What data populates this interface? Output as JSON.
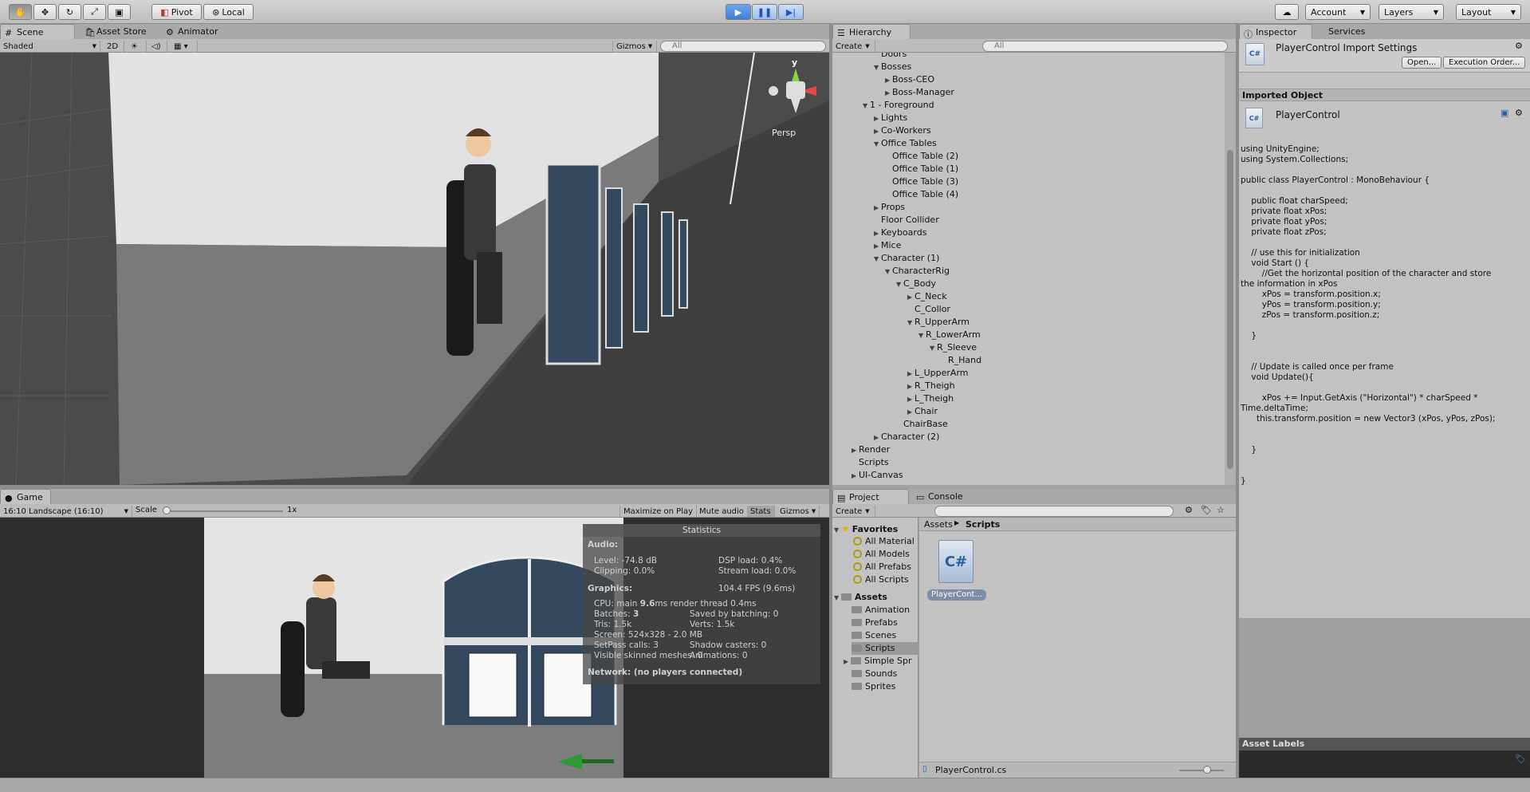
{
  "toolbar": {
    "pivot": "Pivot",
    "local": "Local",
    "account": "Account",
    "layers": "Layers",
    "layout": "Layout"
  },
  "scene": {
    "tab": "Scene",
    "tab2": "Asset Store",
    "tab3": "Animator",
    "shaded": "Shaded",
    "two_d": "2D",
    "gizmos": "Gizmos",
    "search": "All",
    "persp": "Persp",
    "axis_y": "y"
  },
  "game": {
    "tab": "Game",
    "aspect": "16:10 Landscape (16:10)",
    "scale_label": "Scale",
    "scale_val": "1x",
    "maximize": "Maximize on Play",
    "mute": "Mute audio",
    "stats": "Stats",
    "gizmos": "Gizmos"
  },
  "stats": {
    "title": "Statistics",
    "audio_h": "Audio:",
    "level": "Level: -74.8 dB",
    "clipping": "Clipping: 0.0%",
    "dsp": "DSP load: 0.4%",
    "stream": "Stream load: 0.0%",
    "graphics_h": "Graphics:",
    "fps": "104.4 FPS (9.6ms)",
    "cpu_pre": "CPU: main ",
    "cpu_main": "9.6",
    "cpu_post": "ms  render thread 0.4ms",
    "batches_pre": "Batches: ",
    "batches": "3",
    "saved": "Saved by batching: 0",
    "tris": "Tris: 1.5k",
    "verts": "Verts: 1.5k",
    "screen": "Screen: 524x328 - 2.0 MB",
    "setpass": "SetPass calls: 3",
    "shadow": "Shadow casters: 0",
    "skinned": "Visible skinned meshes: 0",
    "animations": "Animations: 0",
    "network": "Network: (no players connected)"
  },
  "hierarchy": {
    "tab": "Hierarchy",
    "create": "Create",
    "search": "All",
    "rows": [
      {
        "label": "Doors",
        "depth": 2,
        "tri": ""
      },
      {
        "label": "Bosses",
        "depth": 2,
        "tri": "▼"
      },
      {
        "label": "Boss-CEO",
        "depth": 3,
        "tri": "▶"
      },
      {
        "label": "Boss-Manager",
        "depth": 3,
        "tri": "▶"
      },
      {
        "label": "1 - Foreground",
        "depth": 1,
        "tri": "▼"
      },
      {
        "label": "Lights",
        "depth": 2,
        "tri": "▶"
      },
      {
        "label": "Co-Workers",
        "depth": 2,
        "tri": "▶"
      },
      {
        "label": "Office Tables",
        "depth": 2,
        "tri": "▼"
      },
      {
        "label": "Office Table (2)",
        "depth": 3,
        "tri": ""
      },
      {
        "label": "Office Table (1)",
        "depth": 3,
        "tri": ""
      },
      {
        "label": "Office Table (3)",
        "depth": 3,
        "tri": ""
      },
      {
        "label": "Office Table (4)",
        "depth": 3,
        "tri": ""
      },
      {
        "label": "Props",
        "depth": 2,
        "tri": "▶"
      },
      {
        "label": "Floor Collider",
        "depth": 2,
        "tri": ""
      },
      {
        "label": "Keyboards",
        "depth": 2,
        "tri": "▶"
      },
      {
        "label": "Mice",
        "depth": 2,
        "tri": "▶"
      },
      {
        "label": "Character (1)",
        "depth": 2,
        "tri": "▼"
      },
      {
        "label": "CharacterRig",
        "depth": 3,
        "tri": "▼"
      },
      {
        "label": "C_Body",
        "depth": 4,
        "tri": "▼"
      },
      {
        "label": "C_Neck",
        "depth": 5,
        "tri": "▶"
      },
      {
        "label": "C_Collor",
        "depth": 5,
        "tri": ""
      },
      {
        "label": "R_UpperArm",
        "depth": 5,
        "tri": "▼"
      },
      {
        "label": "R_LowerArm",
        "depth": 6,
        "tri": "▼"
      },
      {
        "label": "R_Sleeve",
        "depth": 7,
        "tri": "▼"
      },
      {
        "label": "R_Hand",
        "depth": 8,
        "tri": ""
      },
      {
        "label": "L_UpperArm",
        "depth": 5,
        "tri": "▶"
      },
      {
        "label": "R_Theigh",
        "depth": 5,
        "tri": "▶"
      },
      {
        "label": "L_Theigh",
        "depth": 5,
        "tri": "▶"
      },
      {
        "label": "Chair",
        "depth": 5,
        "tri": "▶"
      },
      {
        "label": "ChairBase",
        "depth": 4,
        "tri": ""
      },
      {
        "label": "Character (2)",
        "depth": 2,
        "tri": "▶"
      },
      {
        "label": "Render",
        "depth": 0,
        "tri": "▶"
      },
      {
        "label": "Scripts",
        "depth": 0,
        "tri": ""
      },
      {
        "label": "UI-Canvas",
        "depth": 0,
        "tri": "▶"
      }
    ]
  },
  "project": {
    "tab": "Project",
    "tab2": "Console",
    "create": "Create",
    "favorites": "Favorites",
    "fav_items": [
      "All Material",
      "All Models",
      "All Prefabs",
      "All Scripts"
    ],
    "assets": "Assets",
    "asset_items": [
      "Animation",
      "Prefabs",
      "Scenes",
      "Scripts",
      "Simple Spr",
      "Sounds",
      "Sprites"
    ],
    "crumb1": "Assets",
    "crumb2": "Scripts",
    "file_label": "PlayerCont...",
    "footer": "PlayerControl.cs",
    "cs": "C#"
  },
  "inspector": {
    "tab": "Inspector",
    "tab2": "Services",
    "title": "PlayerControl Import Settings",
    "open": "Open...",
    "exec": "Execution Order...",
    "imported": "Imported Object",
    "obj": "PlayerControl",
    "labels": "Asset Labels",
    "cs": "C#",
    "code": "using UnityEngine;\nusing System.Collections;\n\npublic class PlayerControl : MonoBehaviour {\n\n    public float charSpeed;\n    private float xPos;\n    private float yPos;\n    private float zPos;\n\n    // use this for initialization\n    void Start () {\n        //Get the horizontal position of the character and store\nthe information in xPos\n        xPos = transform.position.x;\n        yPos = transform.position.y;\n        zPos = transform.position.z;\n\n    }\n\n\n    // Update is called once per frame\n    void Update(){\n\n        xPos += Input.GetAxis (\"Horizontal\") * charSpeed *\nTime.deltaTime;\n      this.transform.position = new Vector3 (xPos, yPos, zPos);\n\n\n    }\n\n\n}"
  }
}
